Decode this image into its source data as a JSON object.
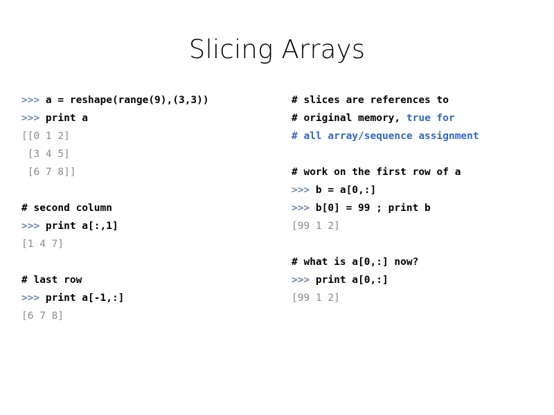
{
  "slide": {
    "title": "Slicing Arrays",
    "background_color": "#ffffff"
  },
  "colors": {
    "prompt": "#6e86b0",
    "code": "#000000",
    "comment": "#000000",
    "highlight": "#3366cc",
    "output": "#8a8a8a",
    "title": "#000000"
  },
  "left_column": {
    "lines": [
      {
        "type": "code",
        "spans": [
          {
            "role": "prompt",
            "text": ">>> "
          },
          {
            "role": "code",
            "text": "a = reshape(range(9),(3,3))"
          }
        ]
      },
      {
        "type": "code",
        "spans": [
          {
            "role": "prompt",
            "text": ">>> "
          },
          {
            "role": "code",
            "text": "print a"
          }
        ]
      },
      {
        "type": "output",
        "spans": [
          {
            "role": "output",
            "text": "[[0 1 2]"
          }
        ]
      },
      {
        "type": "output",
        "spans": [
          {
            "role": "output",
            "text": " [3 4 5]"
          }
        ]
      },
      {
        "type": "output",
        "spans": [
          {
            "role": "output",
            "text": " [6 7 8]]"
          }
        ]
      },
      {
        "type": "blank",
        "spans": [
          {
            "role": "output",
            "text": " "
          }
        ]
      },
      {
        "type": "comment",
        "spans": [
          {
            "role": "comment",
            "text": "# second column"
          }
        ]
      },
      {
        "type": "code",
        "spans": [
          {
            "role": "prompt",
            "text": ">>> "
          },
          {
            "role": "code",
            "text": "print a[:,1]"
          }
        ]
      },
      {
        "type": "output",
        "spans": [
          {
            "role": "output",
            "text": "[1 4 7]"
          }
        ]
      },
      {
        "type": "blank",
        "spans": [
          {
            "role": "output",
            "text": " "
          }
        ]
      },
      {
        "type": "comment",
        "spans": [
          {
            "role": "comment",
            "text": "# last row"
          }
        ]
      },
      {
        "type": "code",
        "spans": [
          {
            "role": "prompt",
            "text": ">>> "
          },
          {
            "role": "code",
            "text": "print a[-1,:]"
          }
        ]
      },
      {
        "type": "output",
        "spans": [
          {
            "role": "output",
            "text": "[6 7 8]"
          }
        ]
      }
    ]
  },
  "right_column": {
    "lines": [
      {
        "type": "comment",
        "spans": [
          {
            "role": "comment",
            "text": "# slices are references to"
          }
        ]
      },
      {
        "type": "comment",
        "spans": [
          {
            "role": "comment",
            "text": "# original memory, "
          },
          {
            "role": "highlight",
            "text": "true for"
          }
        ]
      },
      {
        "type": "comment",
        "spans": [
          {
            "role": "highlight",
            "text": "# all array/sequence assignment"
          }
        ]
      },
      {
        "type": "blank",
        "spans": [
          {
            "role": "output",
            "text": " "
          }
        ]
      },
      {
        "type": "comment",
        "spans": [
          {
            "role": "comment",
            "text": "# work on the first row of a"
          }
        ]
      },
      {
        "type": "code",
        "spans": [
          {
            "role": "prompt",
            "text": ">>> "
          },
          {
            "role": "code",
            "text": "b = a[0,:]"
          }
        ]
      },
      {
        "type": "code",
        "spans": [
          {
            "role": "prompt",
            "text": ">>> "
          },
          {
            "role": "code",
            "text": "b[0] = 99 ; print b"
          }
        ]
      },
      {
        "type": "output",
        "spans": [
          {
            "role": "output",
            "text": "[99 1 2]"
          }
        ]
      },
      {
        "type": "blank",
        "spans": [
          {
            "role": "output",
            "text": " "
          }
        ]
      },
      {
        "type": "comment",
        "spans": [
          {
            "role": "comment",
            "text": "# what is a[0,:] now?"
          }
        ]
      },
      {
        "type": "code",
        "spans": [
          {
            "role": "prompt",
            "text": ">>> "
          },
          {
            "role": "code",
            "text": "print a[0,:]"
          }
        ]
      },
      {
        "type": "output",
        "spans": [
          {
            "role": "output",
            "text": "[99 1 2]"
          }
        ]
      }
    ]
  }
}
